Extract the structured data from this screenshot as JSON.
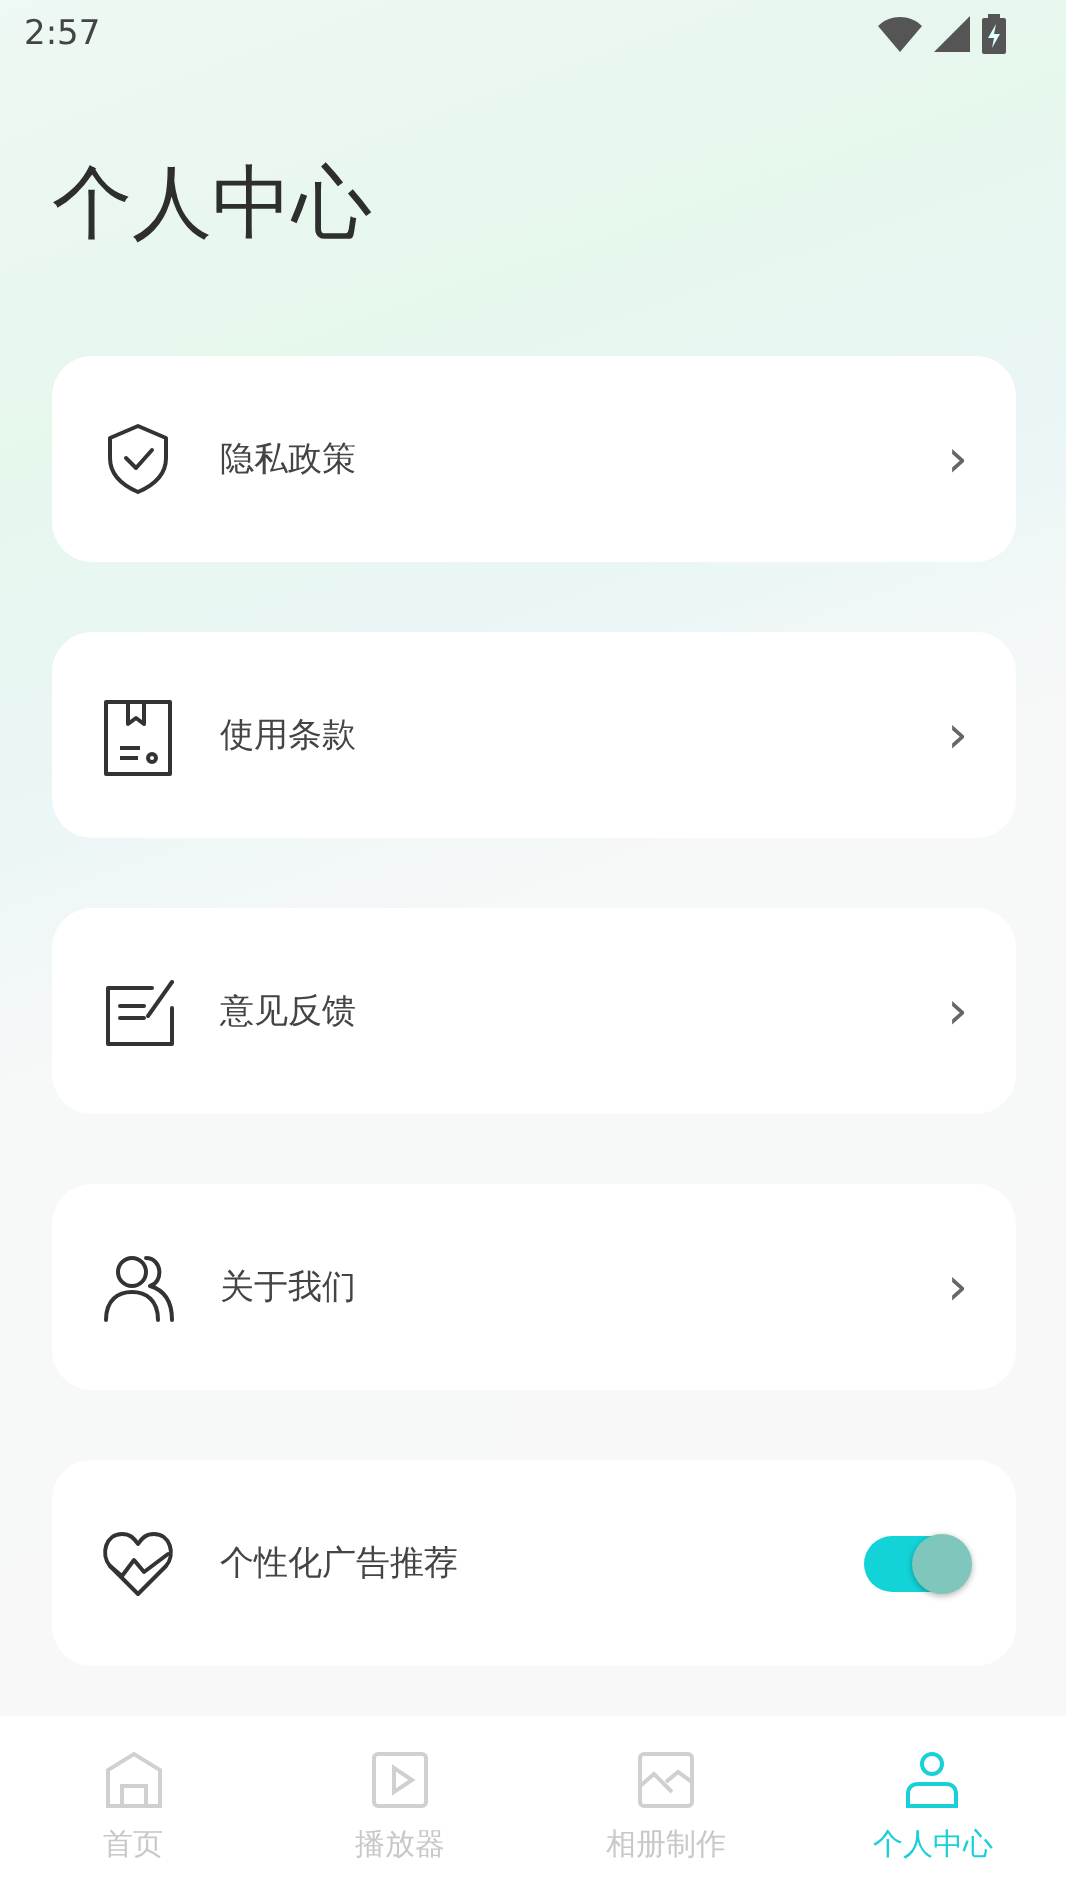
{
  "status_bar": {
    "time": "2:57"
  },
  "title": "个人中心",
  "items": [
    {
      "kind": "link",
      "label": "隐私政策",
      "chevron": "›"
    },
    {
      "kind": "link",
      "label": "使用条款",
      "chevron": "›"
    },
    {
      "kind": "link",
      "label": "意见反馈",
      "chevron": "›"
    },
    {
      "kind": "link",
      "label": "关于我们",
      "chevron": "›"
    },
    {
      "kind": "toggle",
      "label": "个性化广告推荐",
      "on": true
    }
  ],
  "tabs": [
    {
      "label": "首页",
      "selected": false
    },
    {
      "label": "播放器",
      "selected": false
    },
    {
      "label": "相册制作",
      "selected": false
    },
    {
      "label": "个人中心",
      "selected": true
    }
  ]
}
